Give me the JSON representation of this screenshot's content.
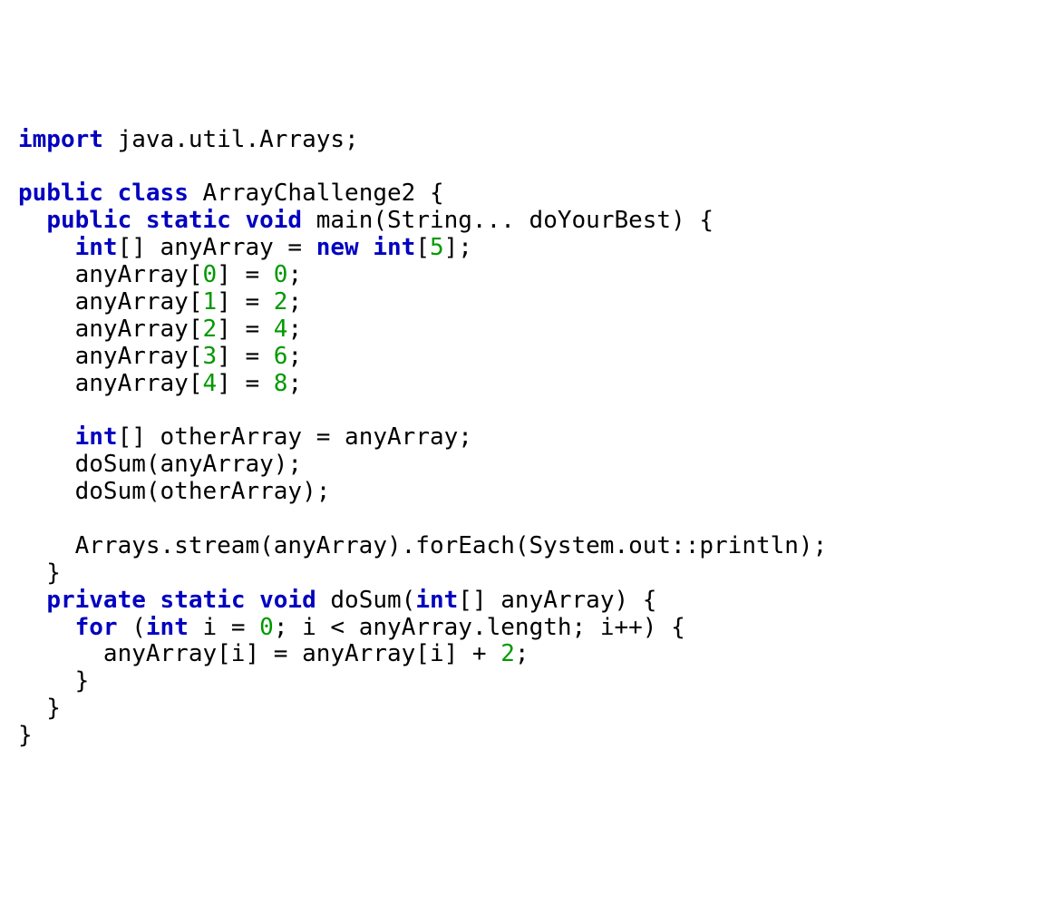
{
  "code": {
    "kw_import": "import",
    "import_pkg": " java.util.Arrays;",
    "blank": "",
    "kw_public": "public",
    "kw_class": "class",
    "class_name": " ArrayChallenge2 {",
    "kw_static": "static",
    "kw_void": "void",
    "main_sig": " main(String... doYourBest) {",
    "kw_int": "int",
    "arr_decl": "[] anyArray = ",
    "kw_new": "new",
    "new_int_open": "[",
    "num_5": "5",
    "new_int_close": "];",
    "assign0a": "    anyArray[",
    "num_0": "0",
    "assign0b": "] = ",
    "num_0b": "0",
    "semi": ";",
    "assign1a": "    anyArray[",
    "num_1": "1",
    "assign1b": "] = ",
    "num_2": "2",
    "assign2a": "    anyArray[",
    "num_2idx": "2",
    "assign2b": "] = ",
    "num_4": "4",
    "assign3a": "    anyArray[",
    "num_3": "3",
    "assign3b": "] = ",
    "num_6": "6",
    "assign4a": "    anyArray[",
    "num_4idx": "4",
    "assign4b": "] = ",
    "num_8": "8",
    "other_decl": "[] otherArray = anyArray;",
    "dosum1": "    doSum(anyArray);",
    "dosum2": "    doSum(otherArray);",
    "streamline": "    Arrays.stream(anyArray).forEach(System.out::println);",
    "closebrace1": "  }",
    "kw_private": "private",
    "dosum_sig_a": " doSum(",
    "dosum_sig_b": "[] anyArray) {",
    "kw_for": "for",
    "for_a": " (",
    "for_b": " i = ",
    "num_0c": "0",
    "for_c": "; i < anyArray.length; i++) {",
    "body_a": "      anyArray[i] = anyArray[i] + ",
    "num_2b": "2",
    "closebrace2": "    }",
    "closebrace3": "  }",
    "closebrace4": "}",
    "sp1": " ",
    "sp2": "  ",
    "sp4": "    "
  }
}
